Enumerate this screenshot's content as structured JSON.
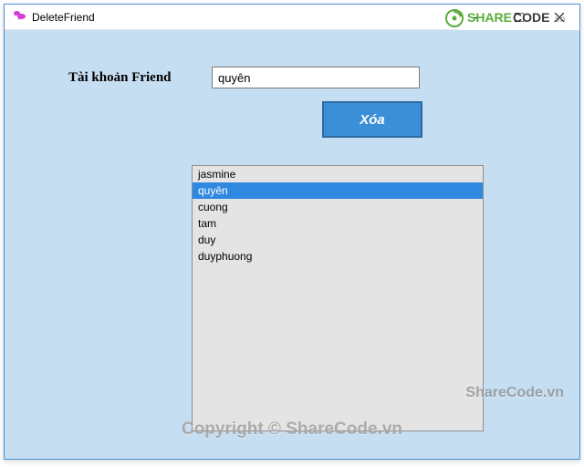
{
  "window": {
    "title": "DeleteFriend"
  },
  "form": {
    "label": "Tài khoản Friend",
    "input_value": "quyên",
    "delete_label": "Xóa"
  },
  "list": {
    "items": [
      "jasmine",
      "quyên",
      "cuong",
      "tam",
      "duy",
      "duyphuong"
    ],
    "selected_index": 1
  },
  "watermark": {
    "brand_prefix": "SHARE",
    "brand_suffix": "CODE",
    "brand_tld": ".vn",
    "line1": "ShareCode.vn",
    "line2": "Copyright © ShareCode.vn"
  }
}
